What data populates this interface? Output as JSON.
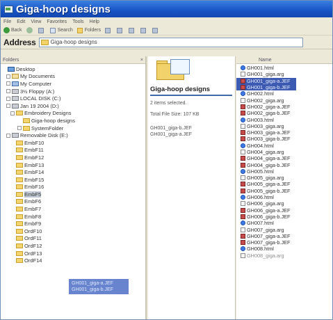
{
  "window": {
    "title": "Giga-hoop designs"
  },
  "menu": [
    "File",
    "Edit",
    "View",
    "Favorites",
    "Tools",
    "Help"
  ],
  "toolbar": {
    "back": "Back",
    "search": "Search",
    "folders": "Folders"
  },
  "address": {
    "label": "Address",
    "value": "Giga-hoop designs"
  },
  "folders_pane": {
    "header": "Folders",
    "tree": [
      {
        "label": "Desktop",
        "indent": 0,
        "icon": "desk",
        "exp": ""
      },
      {
        "label": "My Documents",
        "indent": 1,
        "icon": "docs",
        "exp": "+"
      },
      {
        "label": "My Computer",
        "indent": 1,
        "icon": "comp",
        "exp": "−"
      },
      {
        "label": "3½ Floppy (A:)",
        "indent": 2,
        "icon": "drive",
        "exp": "+"
      },
      {
        "label": "LOCAL DISK (C:)",
        "indent": 2,
        "icon": "drive",
        "exp": "+"
      },
      {
        "label": "Jan 19 2004 (D:)",
        "indent": 2,
        "icon": "drive",
        "exp": "−"
      },
      {
        "label": "Embroidery Designs",
        "indent": 3,
        "icon": "folder",
        "exp": "−"
      },
      {
        "label": "Giga-hoop designs",
        "indent": 4,
        "icon": "folder",
        "exp": ""
      },
      {
        "label": "SystemFolder",
        "indent": 4,
        "icon": "folder",
        "exp": "+"
      },
      {
        "label": "Removable Disk (E:)",
        "indent": 2,
        "icon": "drive",
        "exp": "−"
      },
      {
        "label": "EmbF10",
        "indent": 3,
        "icon": "folder",
        "exp": ""
      },
      {
        "label": "EmbF11",
        "indent": 3,
        "icon": "folder",
        "exp": ""
      },
      {
        "label": "EmbF12",
        "indent": 3,
        "icon": "folder",
        "exp": ""
      },
      {
        "label": "EmbF13",
        "indent": 3,
        "icon": "folder",
        "exp": ""
      },
      {
        "label": "EmbF14",
        "indent": 3,
        "icon": "folder",
        "exp": ""
      },
      {
        "label": "EmbF15",
        "indent": 3,
        "icon": "folder",
        "exp": ""
      },
      {
        "label": "EmbF16",
        "indent": 3,
        "icon": "folder",
        "exp": ""
      },
      {
        "label": "EmbF5",
        "indent": 3,
        "icon": "folder",
        "exp": "",
        "selected": true
      },
      {
        "label": "EmbF6",
        "indent": 3,
        "icon": "folder",
        "exp": ""
      },
      {
        "label": "EmbF7",
        "indent": 3,
        "icon": "folder",
        "exp": ""
      },
      {
        "label": "EmbF8",
        "indent": 3,
        "icon": "folder",
        "exp": ""
      },
      {
        "label": "EmbF9",
        "indent": 3,
        "icon": "folder",
        "exp": ""
      },
      {
        "label": "OrdF10",
        "indent": 3,
        "icon": "folder",
        "exp": ""
      },
      {
        "label": "OrdF11",
        "indent": 3,
        "icon": "folder",
        "exp": ""
      },
      {
        "label": "OrdF12",
        "indent": 3,
        "icon": "folder",
        "exp": ""
      },
      {
        "label": "OrdF13",
        "indent": 3,
        "icon": "folder",
        "exp": ""
      },
      {
        "label": "OrdF14",
        "indent": 3,
        "icon": "folder",
        "exp": ""
      }
    ]
  },
  "drag_ghost": {
    "lines": [
      "GH001_giga-a.JEF",
      "GH001_giga-b.JEF"
    ]
  },
  "details": {
    "folder_title": "Giga-hoop designs",
    "selected_count": "2 items selected.",
    "total_size": "Total File Size: 107 KB",
    "selected_files": [
      "GH001_giga-b.JEF",
      "GH001_giga-a.JEF"
    ]
  },
  "files_pane": {
    "header": "Name",
    "files": [
      {
        "name": "GH001.html",
        "type": "html"
      },
      {
        "name": "GH001_giga.arg",
        "type": "arg"
      },
      {
        "name": "GH001_giga-a.JEF",
        "type": "jef",
        "selected": true
      },
      {
        "name": "GH001_giga-b.JEF",
        "type": "jef",
        "selected": true
      },
      {
        "name": "GH002.html",
        "type": "html"
      },
      {
        "name": "GH002_giga.arg",
        "type": "arg"
      },
      {
        "name": "GH002_giga-a.JEF",
        "type": "jef"
      },
      {
        "name": "GH002_giga-b.JEF",
        "type": "jef"
      },
      {
        "name": "GH003.html",
        "type": "html"
      },
      {
        "name": "GH003_giga.arg",
        "type": "arg"
      },
      {
        "name": "GH003_giga-a.JEF",
        "type": "jef"
      },
      {
        "name": "GH003_giga-b.JEF",
        "type": "jef"
      },
      {
        "name": "GH004.html",
        "type": "html"
      },
      {
        "name": "GH004_giga.arg",
        "type": "arg"
      },
      {
        "name": "GH004_giga-a.JEF",
        "type": "jef"
      },
      {
        "name": "GH004_giga-b.JEF",
        "type": "jef"
      },
      {
        "name": "GH005.html",
        "type": "html"
      },
      {
        "name": "GH005_giga.arg",
        "type": "arg"
      },
      {
        "name": "GH005_giga-a.JEF",
        "type": "jef"
      },
      {
        "name": "GH005_giga-b.JEF",
        "type": "jef"
      },
      {
        "name": "GH006.html",
        "type": "html"
      },
      {
        "name": "GH006_giga.arg",
        "type": "arg"
      },
      {
        "name": "GH006_giga-a.JEF",
        "type": "jef"
      },
      {
        "name": "GH006_giga-b.JEF",
        "type": "jef"
      },
      {
        "name": "GH007.html",
        "type": "html"
      },
      {
        "name": "GH007_giga.arg",
        "type": "arg"
      },
      {
        "name": "GH007_giga-a.JEF",
        "type": "jef"
      },
      {
        "name": "GH007_giga-b.JEF",
        "type": "jef"
      },
      {
        "name": "GH008.html",
        "type": "html"
      },
      {
        "name": "GH008_giga.arg",
        "type": "arg",
        "partial": true
      }
    ]
  },
  "colors": {
    "titlebar": "#1753c5",
    "selection": "#3d5ab2",
    "folder": "#f2d26b"
  }
}
